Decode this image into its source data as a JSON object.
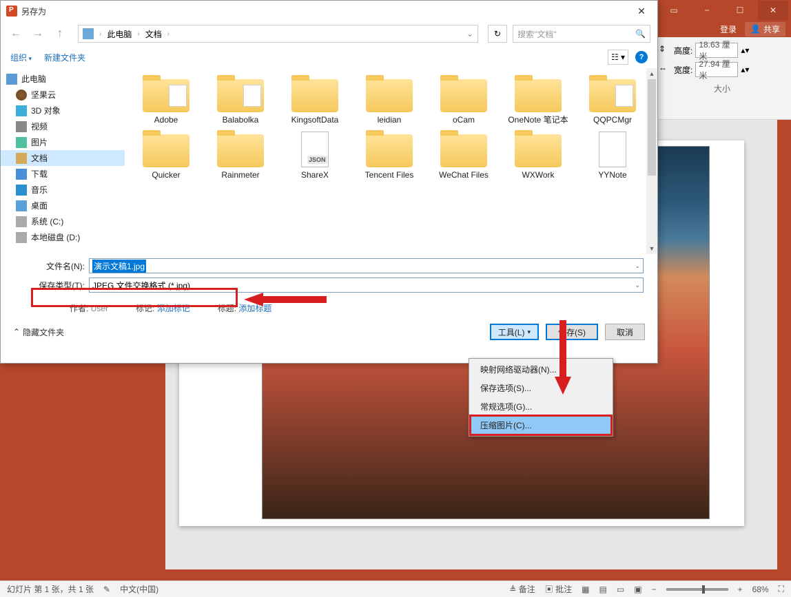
{
  "ppt": {
    "login": "登录",
    "share": "共享",
    "height_label": "高度:",
    "height_val": "18.63 厘米",
    "width_label": "宽度:",
    "width_val": "27.94 厘米",
    "size_group": "大小",
    "status_slide": "幻灯片 第 1 张，共 1 张",
    "status_lang": "中文(中国)",
    "status_notes": "备注",
    "status_comments": "批注",
    "zoom": "68%"
  },
  "dialog": {
    "title": "另存为",
    "breadcrumb": {
      "root": "此电脑",
      "folder": "文档"
    },
    "search_placeholder": "搜索\"文档\"",
    "organize": "组织",
    "new_folder": "新建文件夹",
    "sidebar": [
      {
        "label": "此电脑",
        "icon": "si-pc",
        "root": true
      },
      {
        "label": "坚果云",
        "icon": "si-nut"
      },
      {
        "label": "3D 对象",
        "icon": "si-3d"
      },
      {
        "label": "视频",
        "icon": "si-video"
      },
      {
        "label": "图片",
        "icon": "si-pic"
      },
      {
        "label": "文档",
        "icon": "si-doc",
        "selected": true
      },
      {
        "label": "下载",
        "icon": "si-down"
      },
      {
        "label": "音乐",
        "icon": "si-music"
      },
      {
        "label": "桌面",
        "icon": "si-desk"
      },
      {
        "label": "系统 (C:)",
        "icon": "si-drive"
      },
      {
        "label": "本地磁盘 (D:)",
        "icon": "si-drive"
      }
    ],
    "files_row1": [
      {
        "label": "Adobe",
        "type": "folder-open"
      },
      {
        "label": "Balabolka",
        "type": "folder-open"
      },
      {
        "label": "KingsoftData",
        "type": "folder"
      },
      {
        "label": "leidian",
        "type": "folder"
      },
      {
        "label": "oCam",
        "type": "folder"
      },
      {
        "label": "OneNote 笔记本",
        "type": "folder"
      },
      {
        "label": "QQPCMgr",
        "type": "folder-open"
      }
    ],
    "files_row2": [
      {
        "label": "Quicker",
        "type": "folder"
      },
      {
        "label": "Rainmeter",
        "type": "folder"
      },
      {
        "label": "ShareX",
        "type": "file",
        "badge": "JSON"
      },
      {
        "label": "Tencent Files",
        "type": "folder"
      },
      {
        "label": "WeChat Files",
        "type": "folder"
      },
      {
        "label": "WXWork",
        "type": "folder"
      },
      {
        "label": "YYNote",
        "type": "file",
        "badge": ""
      }
    ],
    "filename_label": "文件名(N):",
    "filename_value": "演示文稿1.jpg",
    "filetype_label": "保存类型(T):",
    "filetype_value": "JPEG 文件交换格式 (*.jpg)",
    "author_label": "作者:",
    "author_value": "User",
    "tags_label": "标记:",
    "tags_value": "添加标记",
    "title_label": "标题:",
    "title_value": "添加标题",
    "hide_folders": "隐藏文件夹",
    "tools_btn": "工具(L)",
    "save_btn": "保存(S)",
    "cancel_btn": "取消"
  },
  "tools_menu": [
    "映射网络驱动器(N)...",
    "保存选项(S)...",
    "常规选项(G)...",
    "压缩图片(C)..."
  ]
}
